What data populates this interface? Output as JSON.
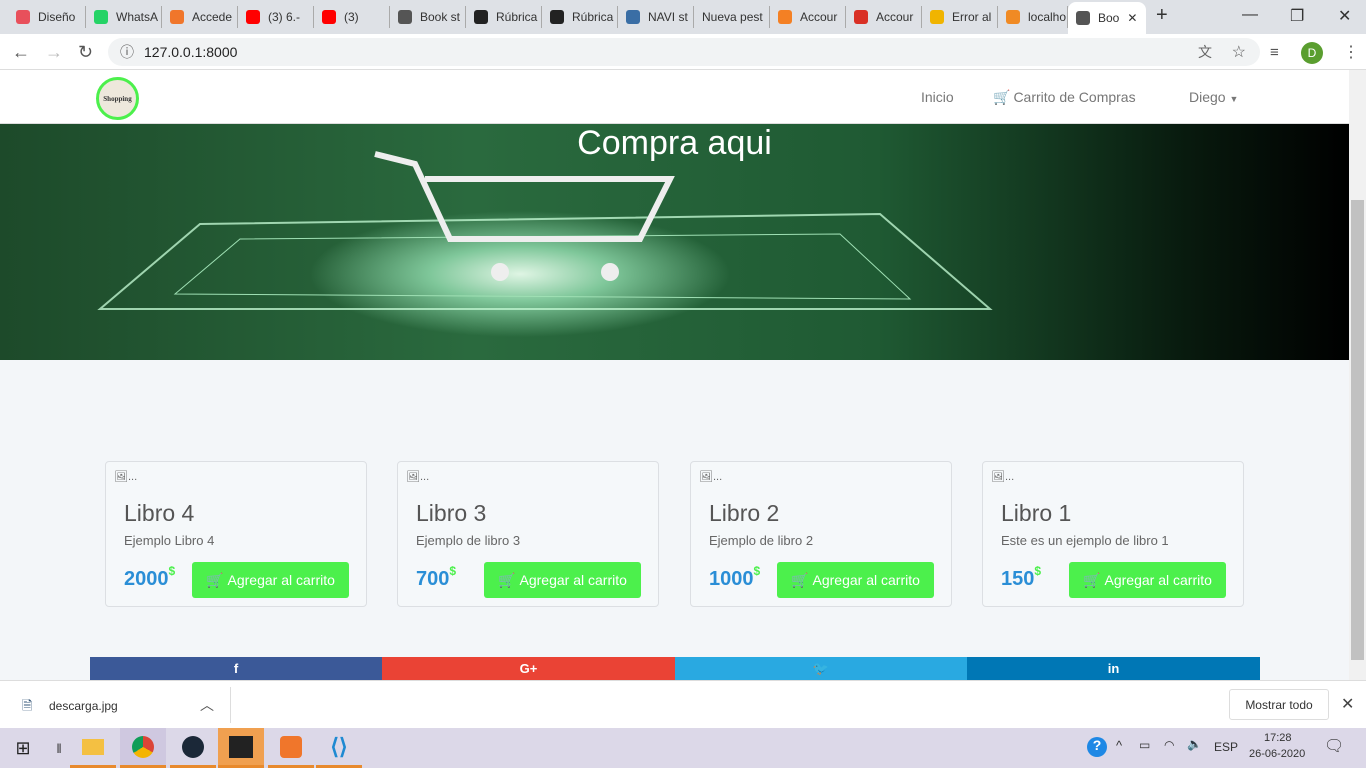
{
  "browser": {
    "tabs": [
      {
        "label": "Diseño",
        "color": "#e8505b"
      },
      {
        "label": "WhatsA",
        "color": "#25d366"
      },
      {
        "label": "Accede",
        "color": "#f0762b"
      },
      {
        "label": "(3) 6.-",
        "color": "#ff0000"
      },
      {
        "label": "(3)",
        "color": "#ff0000"
      },
      {
        "label": "Book st",
        "color": "#555555"
      },
      {
        "label": "Rúbrica",
        "color": "#222222"
      },
      {
        "label": "Rúbrica",
        "color": "#222222"
      },
      {
        "label": "NAVI st",
        "color": "#3a6ea5"
      },
      {
        "label": "Nueva pest",
        "color": ""
      },
      {
        "label": "Accour",
        "color": "#f48024"
      },
      {
        "label": "Accour",
        "color": "#d93025"
      },
      {
        "label": "Error al",
        "color": "#f0b400"
      },
      {
        "label": "localho",
        "color": "#f08a24"
      },
      {
        "label": "Boo",
        "color": "#555555"
      }
    ],
    "url": "127.0.0.1:8000",
    "profile_initial": "D"
  },
  "site": {
    "logo_text": "Shopping",
    "nav": {
      "home": "Inicio",
      "cart": "Carrito de Compras",
      "user": "Diego"
    },
    "hero_title": "Compra aqui",
    "products": [
      {
        "img_alt": "...",
        "title": "Libro 4",
        "desc": "Ejemplo Libro 4",
        "price": "2000",
        "currency": "$",
        "button": "Agregar al carrito"
      },
      {
        "img_alt": "...",
        "title": "Libro 3",
        "desc": "Ejemplo de libro 3",
        "price": "700",
        "currency": "$",
        "button": "Agregar al carrito"
      },
      {
        "img_alt": "...",
        "title": "Libro 2",
        "desc": "Ejemplo de libro 2",
        "price": "1000",
        "currency": "$",
        "button": "Agregar al carrito"
      },
      {
        "img_alt": "...",
        "title": "Libro 1",
        "desc": "Este es un ejemplo de libro 1",
        "price": "150",
        "currency": "$",
        "button": "Agregar al carrito"
      }
    ],
    "social": [
      {
        "icon": "f",
        "name": "facebook",
        "color": "#3b5998"
      },
      {
        "icon": "G+",
        "name": "google-plus",
        "color": "#ea4335"
      },
      {
        "icon": "🐦",
        "name": "twitter",
        "color": "#29a9e1"
      },
      {
        "icon": "in",
        "name": "linkedin",
        "color": "#0077b5"
      }
    ]
  },
  "downloads": {
    "file": "descarga.jpg",
    "show_all": "Mostrar todo"
  },
  "taskbar": {
    "lang": "ESP",
    "time": "17:28",
    "date": "26-06-2020"
  }
}
